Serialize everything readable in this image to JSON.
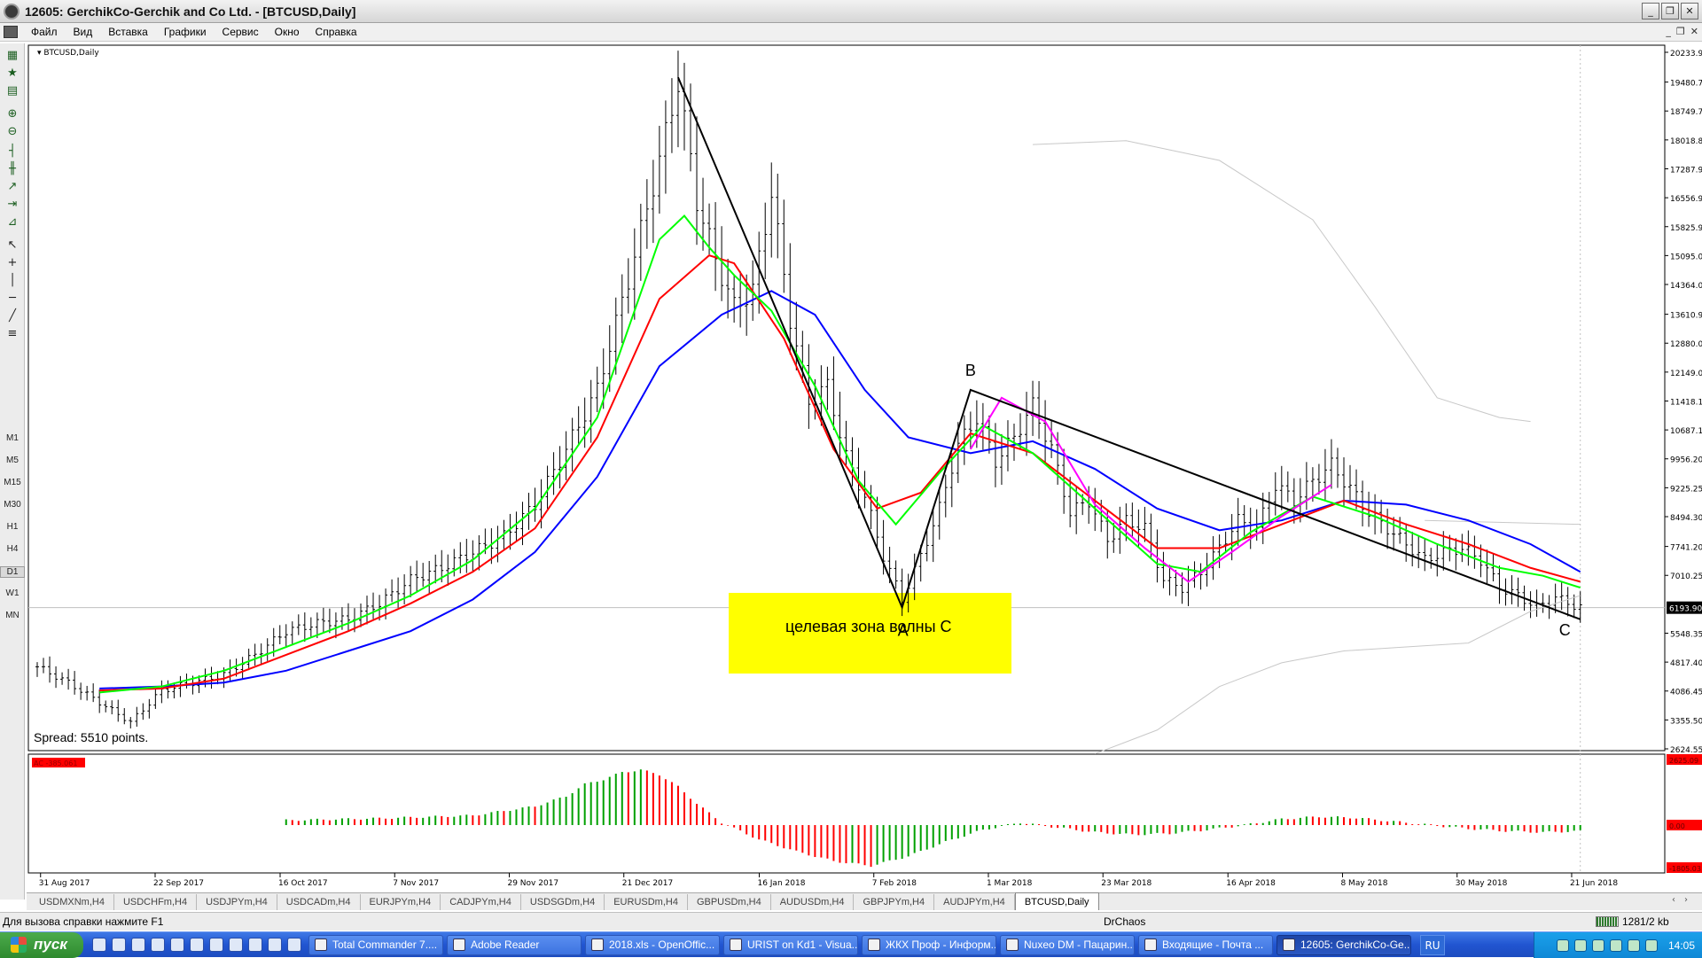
{
  "window": {
    "title": "12605: GerchikCo-Gerchik and Co Ltd. - [BTCUSD,Daily]",
    "buttons": [
      "_",
      "❐",
      "✕"
    ]
  },
  "menu": {
    "items": [
      "Файл",
      "Вид",
      "Вставка",
      "Графики",
      "Сервис",
      "Окно",
      "Справка"
    ],
    "mdi_buttons": [
      "_",
      "❐",
      "✕"
    ]
  },
  "toolbar": {
    "timeframes": [
      "M1",
      "M5",
      "M15",
      "M30",
      "H1",
      "H4",
      "D1",
      "W1",
      "MN"
    ],
    "selected": "D1"
  },
  "chart": {
    "symbol_label": "BTCUSD,Daily",
    "spread_text": "Spread: 5510 points.",
    "current_price": "6193.90",
    "indicator_label": "AC -385.061",
    "indicator_max": "2625.09",
    "indicator_zero": "0.00",
    "indicator_min": "-1805.03",
    "annotation_text": "целевая зона волны С",
    "wave_labels": {
      "a": "A",
      "b": "B",
      "c": "C"
    },
    "colors": {
      "highlight": "#ffff00",
      "jaw": "#0000ff",
      "teeth": "#ff0000",
      "lips": "#00ff00",
      "projection": "#ff00ff",
      "ac_up": "#00a000",
      "ac_down": "#ff0000"
    }
  },
  "chart_data": {
    "type": "candlestick",
    "symbol": "BTCUSD",
    "timeframe": "Daily",
    "price_axis_ticks": [
      20233.9,
      19480.7,
      18749.75,
      18018.85,
      17287.95,
      16556.9,
      15825.95,
      15095.0,
      14364.05,
      13610.95,
      12880.0,
      12149.05,
      11418.1,
      10687.15,
      9956.2,
      9225.25,
      8494.3,
      7741.2,
      7010.25,
      6193.9,
      5548.35,
      4817.4,
      4086.45,
      3355.5,
      2624.55
    ],
    "ylim": [
      2624.55,
      20233.9
    ],
    "date_ticks": [
      "31 Aug 2017",
      "22 Sep 2017",
      "16 Oct 2017",
      "7 Nov 2017",
      "29 Nov 2017",
      "21 Dec 2017",
      "16 Jan 2018",
      "7 Feb 2018",
      "1 Mar 2018",
      "23 Mar 2018",
      "16 Apr 2018",
      "8 May 2018",
      "30 May 2018",
      "21 Jun 2018"
    ],
    "close_path": [
      [
        0,
        4700
      ],
      [
        5,
        4300
      ],
      [
        10,
        3800
      ],
      [
        15,
        3300
      ],
      [
        20,
        4100
      ],
      [
        25,
        4300
      ],
      [
        30,
        4500
      ],
      [
        35,
        5000
      ],
      [
        40,
        5600
      ],
      [
        45,
        5800
      ],
      [
        50,
        5900
      ],
      [
        55,
        6300
      ],
      [
        60,
        6900
      ],
      [
        65,
        7200
      ],
      [
        70,
        7600
      ],
      [
        75,
        8000
      ],
      [
        80,
        8800
      ],
      [
        85,
        10200
      ],
      [
        90,
        11700
      ],
      [
        95,
        14500
      ],
      [
        100,
        17500
      ],
      [
        103,
        19500
      ],
      [
        106,
        16500
      ],
      [
        109,
        15000
      ],
      [
        112,
        13800
      ],
      [
        115,
        14200
      ],
      [
        118,
        16700
      ],
      [
        121,
        13500
      ],
      [
        124,
        11400
      ],
      [
        127,
        11800
      ],
      [
        130,
        10000
      ],
      [
        133,
        9000
      ],
      [
        136,
        7500
      ],
      [
        139,
        6400
      ],
      [
        142,
        7500
      ],
      [
        145,
        8700
      ],
      [
        148,
        10300
      ],
      [
        151,
        11000
      ],
      [
        154,
        9900
      ],
      [
        157,
        10500
      ],
      [
        160,
        11300
      ],
      [
        163,
        10200
      ],
      [
        166,
        8600
      ],
      [
        169,
        8900
      ],
      [
        172,
        7900
      ],
      [
        175,
        8400
      ],
      [
        178,
        8200
      ],
      [
        181,
        6900
      ],
      [
        184,
        6700
      ],
      [
        187,
        7100
      ],
      [
        190,
        7700
      ],
      [
        193,
        8400
      ],
      [
        196,
        8200
      ],
      [
        199,
        9300
      ],
      [
        202,
        8900
      ],
      [
        205,
        9400
      ],
      [
        208,
        9800
      ],
      [
        211,
        9200
      ],
      [
        214,
        8600
      ],
      [
        217,
        8200
      ],
      [
        220,
        7800
      ],
      [
        223,
        7400
      ],
      [
        226,
        7600
      ],
      [
        229,
        7700
      ],
      [
        232,
        7400
      ],
      [
        235,
        6700
      ],
      [
        238,
        6500
      ],
      [
        241,
        6200
      ],
      [
        244,
        6450
      ],
      [
        247,
        6250
      ],
      [
        248,
        6200
      ]
    ],
    "series": [
      {
        "name": "jaw",
        "color": "#0000ff",
        "values": [
          [
            10,
            4150
          ],
          [
            20,
            4200
          ],
          [
            30,
            4300
          ],
          [
            40,
            4600
          ],
          [
            50,
            5100
          ],
          [
            60,
            5600
          ],
          [
            70,
            6400
          ],
          [
            80,
            7600
          ],
          [
            90,
            9500
          ],
          [
            100,
            12300
          ],
          [
            110,
            13600
          ],
          [
            118,
            14200
          ],
          [
            125,
            13600
          ],
          [
            133,
            11700
          ],
          [
            140,
            10500
          ],
          [
            150,
            10100
          ],
          [
            160,
            10400
          ],
          [
            170,
            9700
          ],
          [
            180,
            8700
          ],
          [
            190,
            8150
          ],
          [
            200,
            8400
          ],
          [
            210,
            8900
          ],
          [
            220,
            8800
          ],
          [
            230,
            8400
          ],
          [
            240,
            7800
          ],
          [
            248,
            7100
          ]
        ]
      },
      {
        "name": "teeth",
        "color": "#ff0000",
        "values": [
          [
            10,
            4100
          ],
          [
            20,
            4150
          ],
          [
            30,
            4400
          ],
          [
            40,
            5000
          ],
          [
            50,
            5600
          ],
          [
            60,
            6300
          ],
          [
            70,
            7100
          ],
          [
            80,
            8200
          ],
          [
            90,
            10500
          ],
          [
            100,
            14000
          ],
          [
            108,
            15100
          ],
          [
            112,
            14900
          ],
          [
            120,
            13000
          ],
          [
            128,
            10200
          ],
          [
            135,
            8700
          ],
          [
            142,
            9100
          ],
          [
            150,
            10600
          ],
          [
            160,
            10100
          ],
          [
            170,
            8900
          ],
          [
            180,
            7700
          ],
          [
            190,
            7700
          ],
          [
            200,
            8300
          ],
          [
            210,
            8900
          ],
          [
            220,
            8300
          ],
          [
            230,
            7800
          ],
          [
            240,
            7200
          ],
          [
            248,
            6850
          ]
        ]
      },
      {
        "name": "lips",
        "color": "#00ff00",
        "values": [
          [
            10,
            4050
          ],
          [
            20,
            4200
          ],
          [
            30,
            4600
          ],
          [
            40,
            5200
          ],
          [
            50,
            5800
          ],
          [
            60,
            6500
          ],
          [
            70,
            7400
          ],
          [
            80,
            8700
          ],
          [
            90,
            11000
          ],
          [
            100,
            15500
          ],
          [
            104,
            16100
          ],
          [
            108,
            15300
          ],
          [
            112,
            14600
          ],
          [
            118,
            13700
          ],
          [
            125,
            11800
          ],
          [
            132,
            9400
          ],
          [
            138,
            8300
          ],
          [
            145,
            9600
          ],
          [
            152,
            10800
          ],
          [
            160,
            10100
          ],
          [
            170,
            8700
          ],
          [
            180,
            7300
          ],
          [
            187,
            7100
          ],
          [
            195,
            8100
          ],
          [
            205,
            9000
          ],
          [
            215,
            8500
          ],
          [
            225,
            7800
          ],
          [
            235,
            7200
          ],
          [
            242,
            7000
          ],
          [
            248,
            6700
          ]
        ]
      },
      {
        "name": "projection",
        "color": "#ff00ff",
        "values": [
          [
            150,
            10200
          ],
          [
            155,
            11500
          ],
          [
            162,
            10900
          ],
          [
            170,
            8800
          ],
          [
            178,
            7700
          ],
          [
            185,
            6850
          ],
          [
            192,
            7600
          ],
          [
            200,
            8500
          ],
          [
            208,
            9300
          ]
        ]
      }
    ],
    "wave_points": {
      "A": [
        139,
        6200
      ],
      "B": [
        150,
        11700
      ],
      "C": [
        248,
        5900
      ],
      "top": [
        103,
        19600
      ]
    },
    "ac_histogram_range": [
      -1805.03,
      2625.09
    ],
    "ac_values": [
      [
        40,
        200
      ],
      [
        55,
        280
      ],
      [
        70,
        400
      ],
      [
        80,
        780
      ],
      [
        85,
        1200
      ],
      [
        88,
        1700
      ],
      [
        91,
        1900
      ],
      [
        94,
        2200
      ],
      [
        97,
        2300
      ],
      [
        100,
        2100
      ],
      [
        103,
        1600
      ],
      [
        106,
        900
      ],
      [
        110,
        100
      ],
      [
        116,
        -600
      ],
      [
        122,
        -1100
      ],
      [
        128,
        -1500
      ],
      [
        134,
        -1700
      ],
      [
        140,
        -1300
      ],
      [
        146,
        -700
      ],
      [
        152,
        -200
      ],
      [
        158,
        100
      ],
      [
        164,
        -100
      ],
      [
        170,
        -300
      ],
      [
        176,
        -400
      ],
      [
        182,
        -350
      ],
      [
        188,
        -200
      ],
      [
        194,
        0
      ],
      [
        200,
        250
      ],
      [
        206,
        350
      ],
      [
        212,
        300
      ],
      [
        218,
        150
      ],
      [
        224,
        0
      ],
      [
        230,
        -150
      ],
      [
        236,
        -250
      ],
      [
        242,
        -300
      ],
      [
        248,
        -250
      ]
    ]
  },
  "tabs": [
    "USDMXNm,H4",
    "USDCHFm,H4",
    "USDJPYm,H4",
    "USDCADm,H4",
    "EURJPYm,H4",
    "CADJPYm,H4",
    "USDSGDm,H4",
    "EURUSDm,H4",
    "GBPUSDm,H4",
    "AUDUSDm,H4",
    "GBPJPYm,H4",
    "AUDJPYm,H4",
    "BTCUSD,Daily"
  ],
  "active_tab": "BTCUSD,Daily",
  "status": {
    "hint": "Для вызова справки нажмите F1",
    "profile": "DrChaos",
    "traffic": "1281/2 kb"
  },
  "taskbar": {
    "start_label": "пуск",
    "buttons": [
      "Total Commander 7....",
      "Adobe Reader",
      "2018.xls - OpenOffic...",
      "URIST on Kd1 - Visua...",
      "ЖКХ Проф - Информ...",
      "Nuxeo DM - Пацарин...",
      "Входящие - Почта ...",
      "12605: GerchikCo-Ge..."
    ],
    "active_button": "12605: GerchikCo-Ge...",
    "lang": "RU",
    "clock": "14:05"
  }
}
